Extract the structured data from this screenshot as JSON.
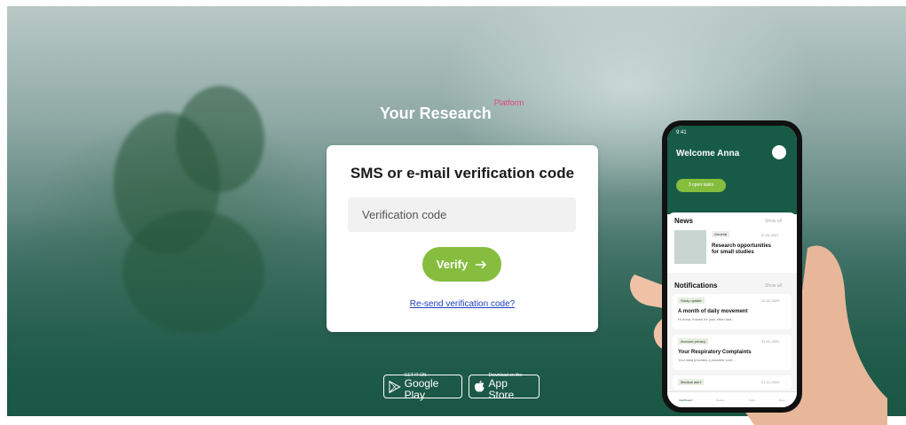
{
  "brand": {
    "name": "Your Research",
    "superscript": "Platform"
  },
  "card": {
    "title": "SMS or e-mail verification code",
    "input_placeholder": "Verification code",
    "verify_label": "Verify",
    "resend_link": "Re-send verification code?"
  },
  "stores": {
    "google": {
      "small": "GET IT ON",
      "big": "Google Play"
    },
    "apple": {
      "small": "Download on the",
      "big": "App Store"
    }
  },
  "phone": {
    "time": "9:41",
    "welcome": "Welcome Anna",
    "open_tasks": "3 open tasks",
    "news_title": "News",
    "show_all": "Show all",
    "news_tag": "General",
    "news_date": "12-03-2023",
    "news_headline": "Research opportunities for small studies",
    "notifications_title": "Notifications",
    "notifications": [
      {
        "tag": "Study update",
        "date": "12-02-2020",
        "title": "A month of daily movement",
        "body": "Hi Anna, thanks for your effort last..."
      },
      {
        "tag": "Account privacy",
        "date": "31-02-2020",
        "title": "Your Respiratory Complaints",
        "body": "Your data provides a possible corri..."
      },
      {
        "tag": "Medical alert",
        "date": "27-01-2020",
        "title": "",
        "body": ""
      }
    ],
    "nav": [
      "Dashboard",
      "Studies",
      "Tasks",
      "More"
    ]
  },
  "colors": {
    "accent": "#86bd3e",
    "brand_pink": "#e0457b",
    "app_green": "#175b46",
    "link": "#1c3fbf"
  },
  "icons": {
    "verify_arrow": "arrow-right-icon",
    "google": "google-play-icon",
    "apple": "apple-icon"
  }
}
